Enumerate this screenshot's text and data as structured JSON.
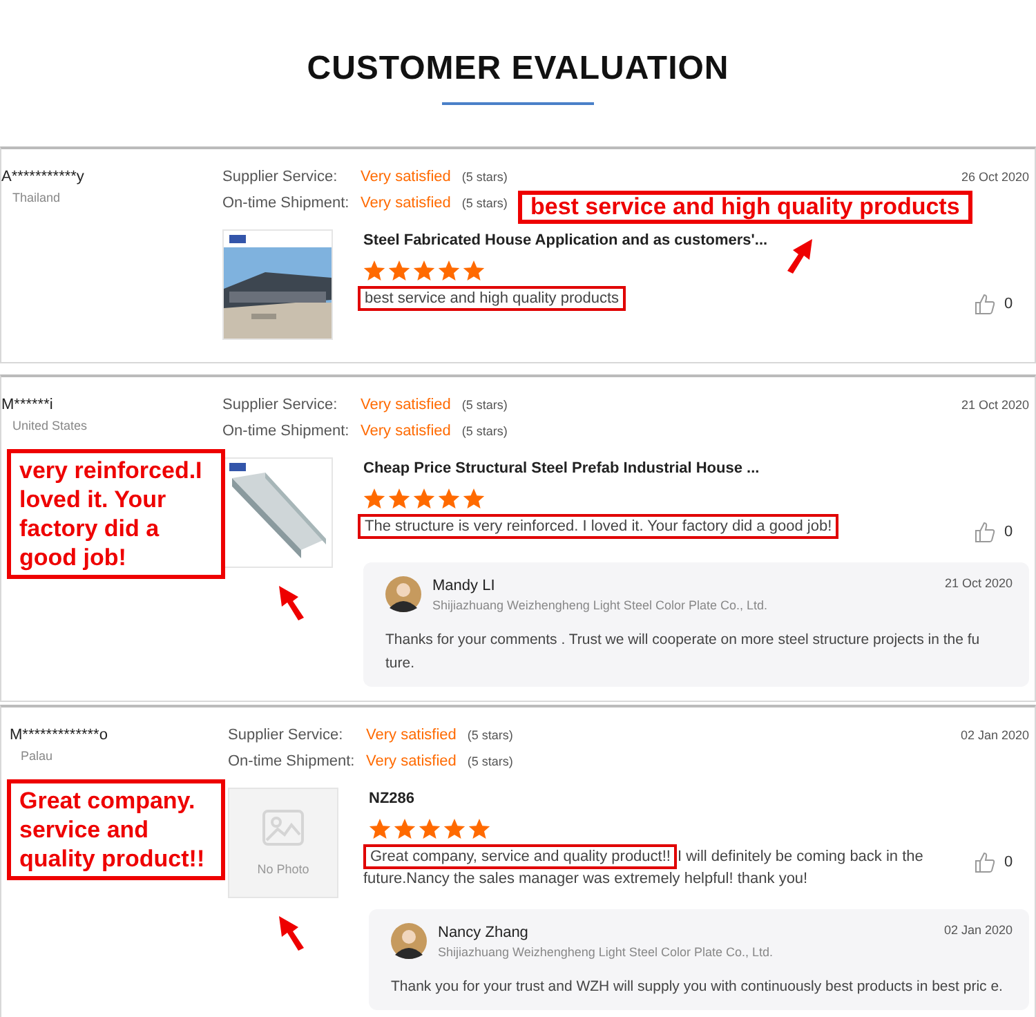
{
  "title": "CUSTOMER EVALUATION",
  "reviews": [
    {
      "name": "A***********y",
      "country": "Thailand",
      "date": "26 Oct 2020",
      "ratings": [
        {
          "label": "Supplier Service:",
          "value": "Very satisfied",
          "stars_text": "(5 stars)"
        },
        {
          "label": "On-time Shipment:",
          "value": "Very satisfied",
          "stars_text": "(5 stars)"
        }
      ],
      "photo": {
        "kind": "picture"
      },
      "product": "Steel Fabricated House Application and as customers'...",
      "stars": 5,
      "review_highlight": "best service and high quality products",
      "likes": "0",
      "callout": "best service and high quality products"
    },
    {
      "name": "M******i",
      "country": "United States",
      "date": "21 Oct 2020",
      "ratings": [
        {
          "label": "Supplier Service:",
          "value": "Very satisfied",
          "stars_text": "(5 stars)"
        },
        {
          "label": "On-time Shipment:",
          "value": "Very satisfied",
          "stars_text": "(5 stars)"
        }
      ],
      "photo": {
        "kind": "picture"
      },
      "product": "Cheap Price Structural Steel Prefab Industrial House ...",
      "stars": 5,
      "review_highlight": "The structure is very reinforced.  I loved it.  Your factory did a good job!",
      "likes": "0",
      "callout": "very reinforced.I loved it. Your factory did a good job!",
      "reply": {
        "name": "Mandy LI",
        "company": "Shijiazhuang Weizhengheng Light Steel Color Plate Co., Ltd.",
        "date": "21 Oct 2020",
        "text": "Thanks for your comments . Trust we will cooperate on more steel structure projects in the fu ture."
      }
    },
    {
      "name": "M*************o",
      "country": "Palau",
      "date": "02 Jan 2020",
      "ratings": [
        {
          "label": "Supplier Service:",
          "value": "Very satisfied",
          "stars_text": "(5 stars)"
        },
        {
          "label": "On-time Shipment:",
          "value": "Very satisfied",
          "stars_text": "(5 stars)"
        }
      ],
      "photo": {
        "kind": "placeholder",
        "label": "No Photo"
      },
      "product": "NZ286",
      "stars": 5,
      "review_highlight": "Great company, service and quality product!!",
      "review_rest": "I will definitely be coming back in the future.Nancy the sales manager was extremely helpful! thank you!",
      "likes": "0",
      "callout": "Great company. service and quality product!!",
      "reply": {
        "name": "Nancy Zhang",
        "company": "Shijiazhuang Weizhengheng Light Steel Color Plate Co., Ltd.",
        "date": "02 Jan 2020",
        "text": "Thank you for your trust and WZH will supply you with continuously best products in best pric e."
      }
    }
  ]
}
